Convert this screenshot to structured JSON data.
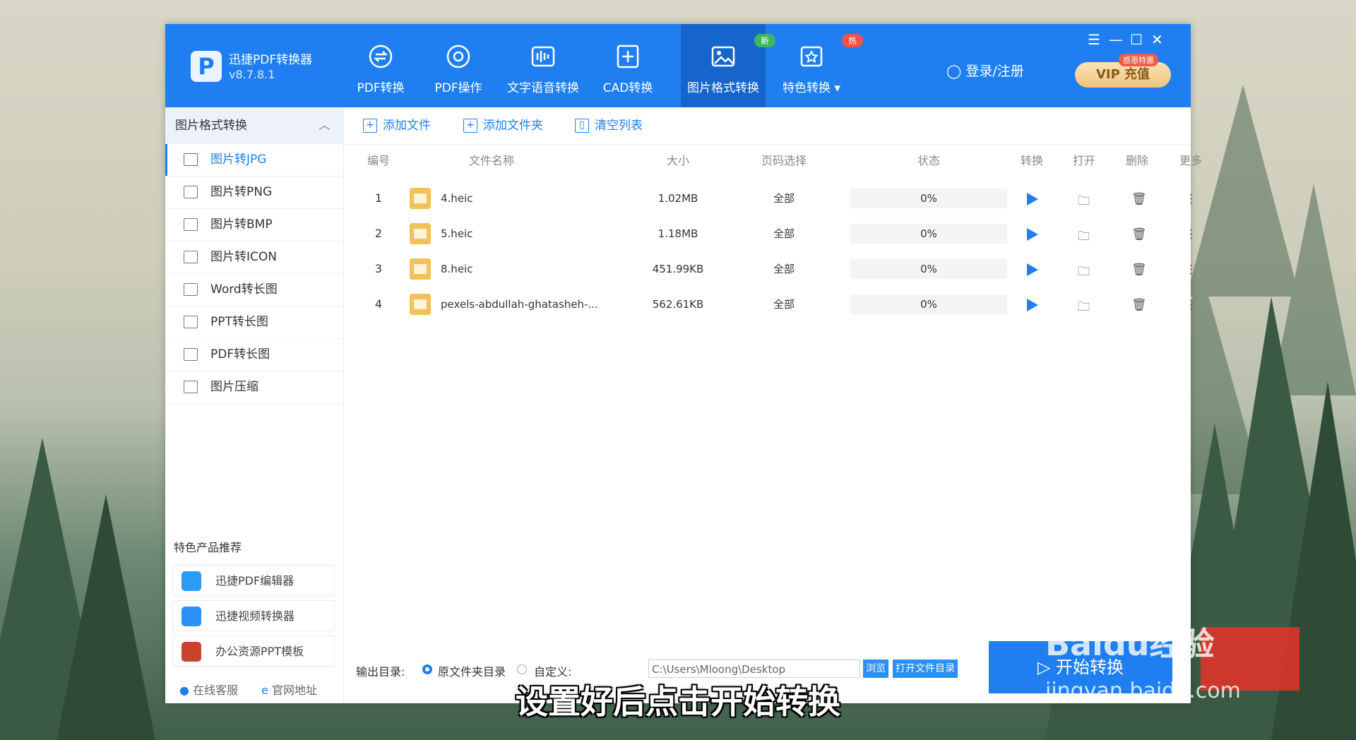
{
  "app": {
    "name": "迅捷PDF转换器",
    "version": "v8.7.8.1",
    "logo": "P"
  },
  "nav": [
    {
      "label": "PDF转换",
      "icon": "pdf-convert-icon"
    },
    {
      "label": "PDF操作",
      "icon": "pdf-operate-icon"
    },
    {
      "label": "文字语音转换",
      "icon": "voice-wave-icon"
    },
    {
      "label": "CAD转换",
      "icon": "cad-icon"
    },
    {
      "label": "图片格式转换",
      "icon": "image-icon",
      "badge": "新",
      "active": true
    },
    {
      "label": "特色转换",
      "icon": "star-icon",
      "badge": "热"
    }
  ],
  "header": {
    "login": "登录/注册",
    "vip": "VIP 充值",
    "vip_tag": "感恩特惠"
  },
  "sidebar": {
    "title": "图片格式转换",
    "items": [
      {
        "label": "图片转JPG",
        "active": true
      },
      {
        "label": "图片转PNG"
      },
      {
        "label": "图片转BMP"
      },
      {
        "label": "图片转ICON"
      },
      {
        "label": "Word转长图"
      },
      {
        "label": "PPT转长图"
      },
      {
        "label": "PDF转长图"
      },
      {
        "label": "图片压缩"
      }
    ],
    "promo_title": "特色产品推荐",
    "promos": [
      {
        "label": "迅捷PDF编辑器"
      },
      {
        "label": "迅捷视频转换器"
      },
      {
        "label": "办公资源PPT模板"
      }
    ],
    "footer": {
      "service": "在线客服",
      "website": "官网地址"
    }
  },
  "toolbar": {
    "add_file": "添加文件",
    "add_folder": "添加文件夹",
    "clear": "清空列表"
  },
  "table": {
    "columns": [
      "编号",
      "文件名称",
      "大小",
      "页码选择",
      "状态",
      "转换",
      "打开",
      "删除",
      "更多"
    ],
    "rows": [
      {
        "no": "1",
        "name": "4.heic",
        "size": "1.02MB",
        "pages": "全部",
        "status": "0%"
      },
      {
        "no": "2",
        "name": "5.heic",
        "size": "1.18MB",
        "pages": "全部",
        "status": "0%"
      },
      {
        "no": "3",
        "name": "8.heic",
        "size": "451.99KB",
        "pages": "全部",
        "status": "0%"
      },
      {
        "no": "4",
        "name": "pexels-abdullah-ghatasheh-...",
        "size": "562.61KB",
        "pages": "全部",
        "status": "0%"
      }
    ]
  },
  "output": {
    "label": "输出目录:",
    "option_original": "原文件夹目录",
    "option_custom": "自定义:",
    "path": "C:\\Users\\Mloong\\Desktop",
    "browse": "浏览",
    "open_dir": "打开文件目录"
  },
  "start_button": "开始转换",
  "subtitle": "设置好后点击开始转换",
  "watermark": {
    "brand": "Baidu经验",
    "url": "jingyan.baidu.com"
  },
  "colors": {
    "primary": "#1f7ff0",
    "active_nav": "#1565cc",
    "badge_new": "#3cb55e",
    "badge_hot": "#f0524a"
  }
}
